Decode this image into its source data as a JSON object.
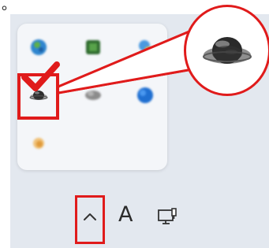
{
  "caption": {
    "prefix": "。"
  },
  "tray": {
    "icons": [
      {
        "name": "globe-app-icon",
        "color": "#2a7fc9"
      },
      {
        "name": "green-square-app-icon",
        "color": "#3b8a3b"
      },
      {
        "name": "cloud-app-icon",
        "color": "#3f8fd8"
      },
      {
        "name": "saturn-planet-icon",
        "color": "#3a3a3a"
      },
      {
        "name": "gray-app-icon",
        "color": "#8d8d8d"
      },
      {
        "name": "blue-circle-app-icon",
        "color": "#1f6fd1"
      },
      {
        "name": "orange-app-icon",
        "color": "#e3a23a"
      }
    ]
  },
  "taskbar": {
    "chevron_icon": "chevron-up-icon",
    "ime_label": "A",
    "network_icon": "network-monitor-icon"
  },
  "colors": {
    "highlight": "#e01b1b",
    "taskbar_bg": "#e3e8ef",
    "flyout_bg": "#f4f6f9"
  }
}
